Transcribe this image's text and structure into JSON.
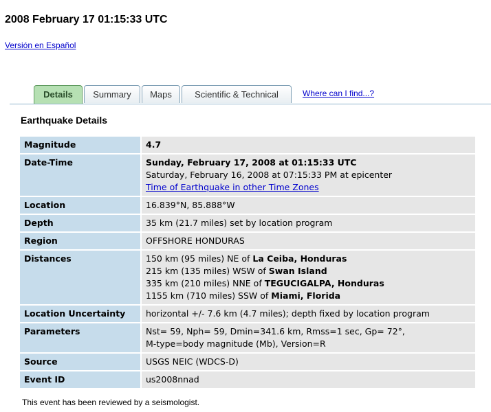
{
  "page_title": "2008 February 17 01:15:33 UTC",
  "language_link": "Versión en Español",
  "tabs": [
    {
      "label": "Details",
      "active": true
    },
    {
      "label": "Summary",
      "active": false
    },
    {
      "label": "Maps",
      "active": false
    },
    {
      "label": "Scientific & Technical",
      "active": false
    }
  ],
  "tab_link": "Where can I find...?",
  "section_title": "Earthquake Details",
  "rows": {
    "magnitude": {
      "label": "Magnitude",
      "value": "4.7"
    },
    "datetime": {
      "label": "Date-Time",
      "utc": "Sunday, February 17, 2008 at 01:15:33 UTC",
      "local": "Saturday, February 16, 2008 at 07:15:33 PM at epicenter",
      "timezones_link": "Time of Earthquake in other Time Zones"
    },
    "location": {
      "label": "Location",
      "value": "16.839°N, 85.888°W"
    },
    "depth": {
      "label": "Depth",
      "value": "35 km (21.7 miles) set by location program"
    },
    "region": {
      "label": "Region",
      "value": "OFFSHORE HONDURAS"
    },
    "distances": {
      "label": "Distances",
      "items": [
        {
          "prefix": "150 km (95 miles) NE of ",
          "place": "La Ceiba, Honduras"
        },
        {
          "prefix": "215 km (135 miles) WSW of ",
          "place": "Swan Island"
        },
        {
          "prefix": "335 km (210 miles) NNE of ",
          "place": "TEGUCIGALPA, Honduras"
        },
        {
          "prefix": "1155 km (710 miles) SSW of ",
          "place": "Miami, Florida"
        }
      ]
    },
    "uncertainty": {
      "label": "Location Uncertainty",
      "value": "horizontal +/- 7.6 km (4.7 miles); depth fixed by location program"
    },
    "parameters": {
      "label": "Parameters",
      "line1": "Nst= 59, Nph= 59, Dmin=341.6 km, Rmss=1 sec, Gp= 72°,",
      "line2": "M-type=body magnitude (Mb), Version=R"
    },
    "source": {
      "label": "Source",
      "value": "USGS NEIC (WDCS-D)"
    },
    "event_id": {
      "label": "Event ID",
      "value": "us2008nnad"
    }
  },
  "footer_note": "This event has been reviewed by a seismologist."
}
